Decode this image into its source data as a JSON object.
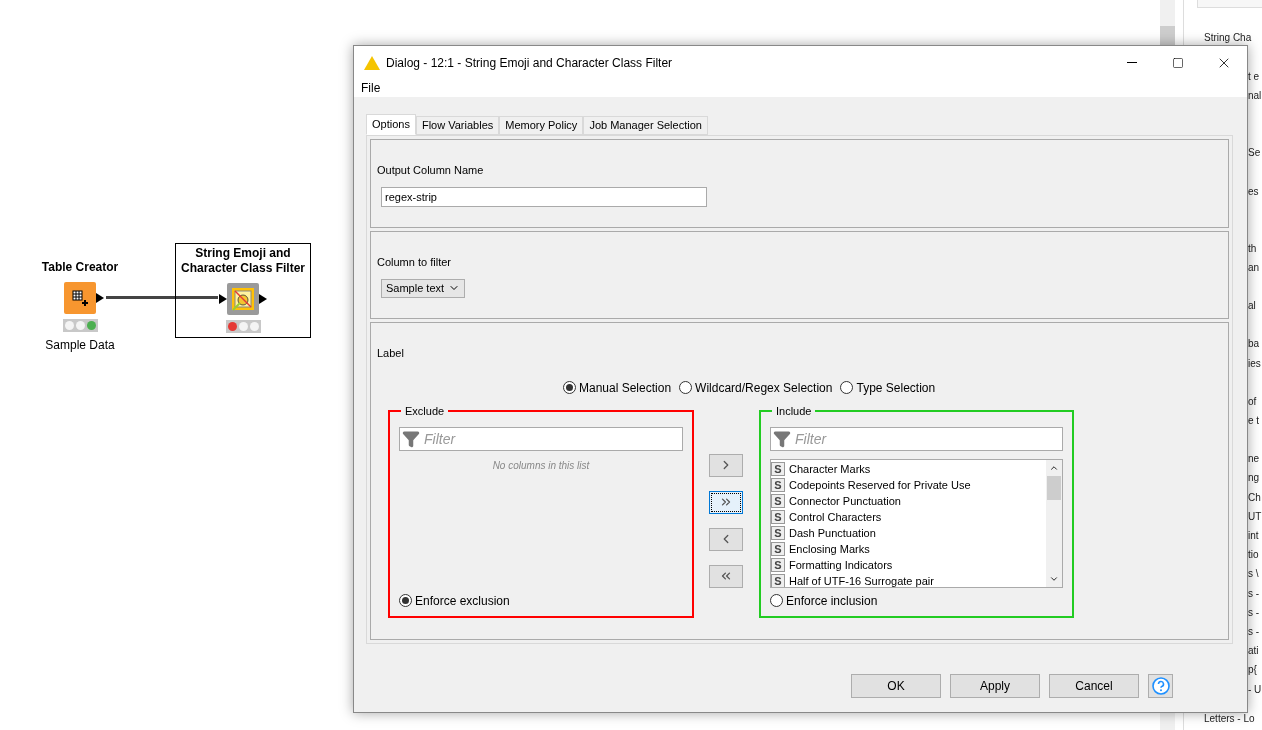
{
  "canvas": {
    "nodes": [
      {
        "title": "Table Creator",
        "caption": "Sample Data",
        "kind": "source",
        "configured": true,
        "executed": true,
        "selected": false
      },
      {
        "title": "String Emoji and Character Class Filter",
        "kind": "filter",
        "configured": false,
        "executed": false,
        "selected": true
      }
    ]
  },
  "side_panel": {
    "paragraphs": [
      [
        {
          "text": "String Cha",
          "kind": "full"
        }
      ],
      [
        {
          "text": "t e",
          "kind": "clipped"
        },
        {
          "text": "nal",
          "kind": "clipped"
        }
      ],
      [
        {
          "text": "Se",
          "kind": "clipped"
        }
      ],
      [
        {
          "text": "es",
          "kind": "clipped"
        }
      ],
      [
        {
          "text": "th",
          "kind": "clipped"
        },
        {
          "text": "an",
          "kind": "clipped"
        }
      ],
      [
        {
          "text": "al",
          "kind": "clipped"
        }
      ],
      [
        {
          "text": "ba",
          "kind": "clipped"
        },
        {
          "text": "ies",
          "kind": "clipped"
        }
      ],
      [
        {
          "text": "of",
          "kind": "clipped"
        },
        {
          "text": "e t",
          "kind": "clipped"
        }
      ],
      [
        {
          "text": "ne",
          "kind": "clipped"
        },
        {
          "text": "ng",
          "kind": "clipped"
        },
        {
          "text": "Ch",
          "kind": "clipped"
        },
        {
          "text": "UT",
          "kind": "clipped"
        },
        {
          "text": "int",
          "kind": "clipped"
        },
        {
          "text": "tio",
          "kind": "clipped"
        },
        {
          "text": "s \\",
          "kind": "clipped"
        },
        {
          "text": "s -",
          "kind": "clipped"
        },
        {
          "text": "s -",
          "kind": "clipped"
        },
        {
          "text": "s -",
          "kind": "clipped"
        },
        {
          "text": "ati",
          "kind": "clipped"
        },
        {
          "text": "p{",
          "kind": "clipped"
        },
        {
          "text": "- U",
          "kind": "clipped"
        },
        {
          "text": "Letters - Lo",
          "kind": "full"
        }
      ]
    ]
  },
  "dialog": {
    "title": "Dialog - 12:1 - String Emoji and Character Class Filter",
    "menu": [
      "File"
    ],
    "tabs": [
      {
        "label": "Options",
        "selected": true
      },
      {
        "label": "Flow Variables",
        "selected": false
      },
      {
        "label": "Memory Policy",
        "selected": false
      },
      {
        "label": "Job Manager Selection",
        "selected": false
      }
    ],
    "output_column": {
      "label": "Output Column Name",
      "value": "regex-strip"
    },
    "column_filter": {
      "label": "Column to filter",
      "value": "Sample text"
    },
    "selection": {
      "label": "Label",
      "modes": [
        {
          "label": "Manual Selection",
          "selected": true
        },
        {
          "label": "Wildcard/Regex Selection",
          "selected": false
        },
        {
          "label": "Type Selection",
          "selected": false
        }
      ],
      "exclude": {
        "title": "Exclude",
        "filter_placeholder": "Filter",
        "empty_message": "No columns in this list",
        "enforce": {
          "label": "Enforce exclusion",
          "selected": true
        }
      },
      "move_buttons": [
        {
          "kind": "add",
          "focused": false
        },
        {
          "kind": "add_all",
          "focused": true
        },
        {
          "kind": "remove",
          "focused": false
        },
        {
          "kind": "remove_all",
          "focused": false
        }
      ],
      "include": {
        "title": "Include",
        "filter_placeholder": "Filter",
        "items": [
          {
            "type": "S",
            "name": "Character Marks"
          },
          {
            "type": "S",
            "name": "Codepoints Reserved for Private Use"
          },
          {
            "type": "S",
            "name": "Connector Punctuation"
          },
          {
            "type": "S",
            "name": "Control Characters"
          },
          {
            "type": "S",
            "name": "Dash Punctuation"
          },
          {
            "type": "S",
            "name": "Enclosing Marks"
          },
          {
            "type": "S",
            "name": "Formatting Indicators"
          },
          {
            "type": "S",
            "name": "Half of UTF-16 Surrogate pair"
          }
        ],
        "enforce": {
          "label": "Enforce inclusion",
          "selected": false
        }
      }
    },
    "buttons": [
      "OK",
      "Apply",
      "Cancel"
    ]
  }
}
